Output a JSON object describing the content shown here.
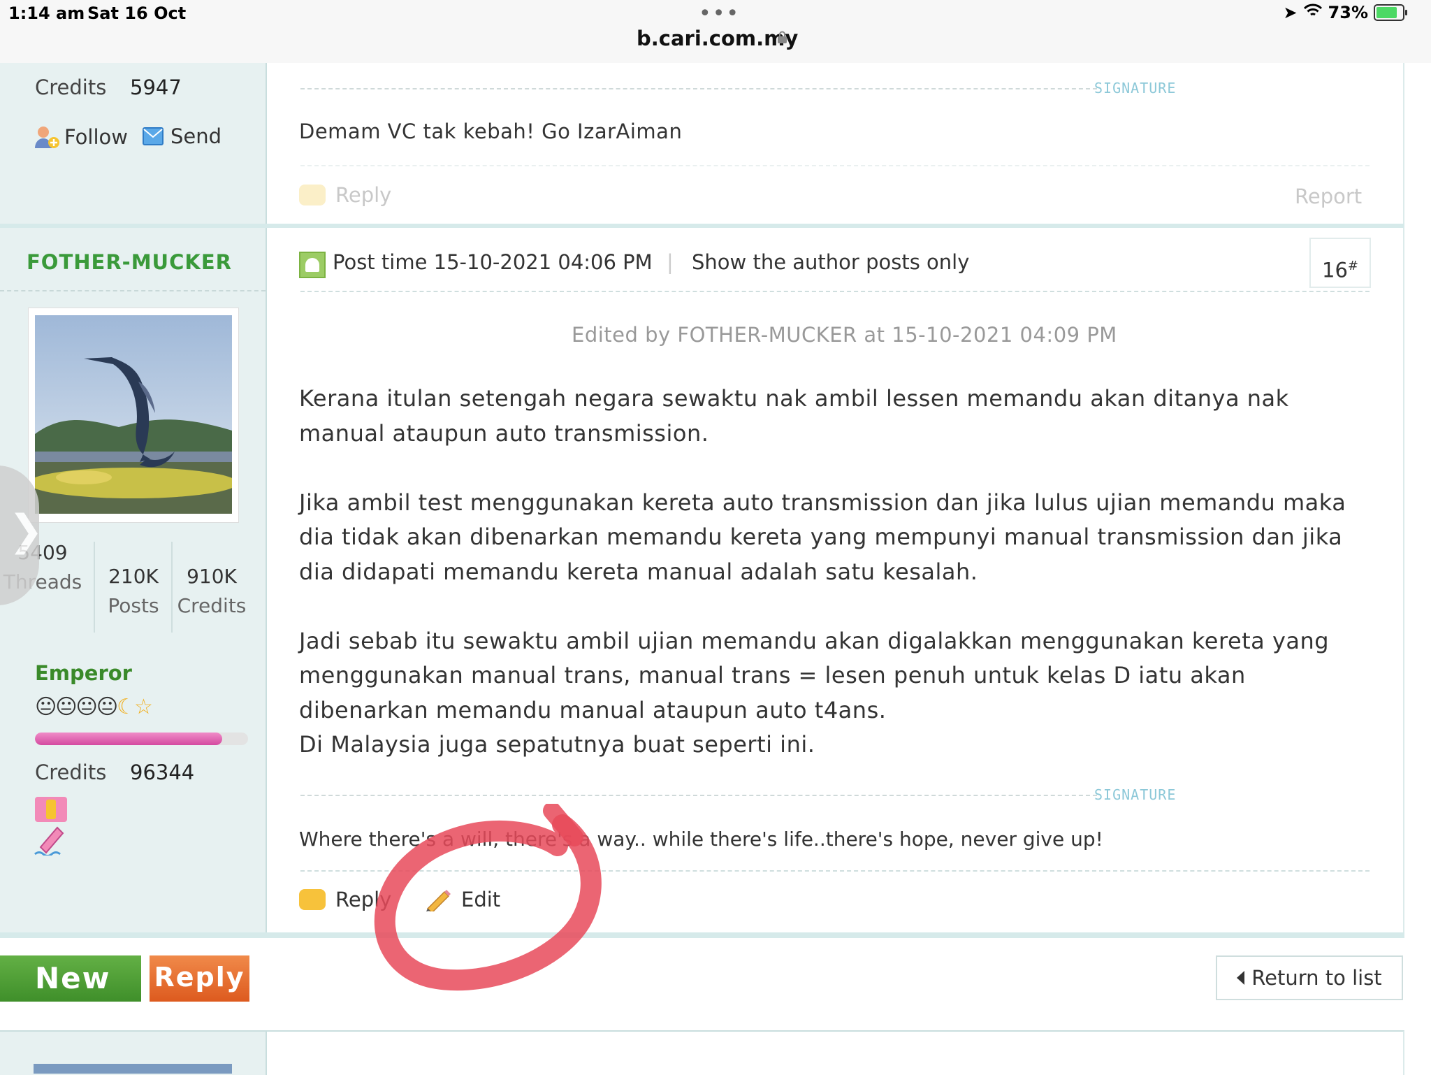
{
  "status_bar": {
    "time": "1:14 am",
    "date": "Sat 16 Oct",
    "url": "b.cari.com.my",
    "battery": "73%"
  },
  "prev_post": {
    "credits_label": "Credits",
    "credits_value": "5947",
    "follow_label": "Follow",
    "send_label": "Send",
    "signature_label": "SIGNATURE",
    "signature_text": "Demam VC tak kebah! Go IzarAiman",
    "reply_label": "Reply",
    "report_label": "Report"
  },
  "post": {
    "author": "FOTHER-MUCKER",
    "stats": [
      {
        "value": "5409",
        "label": "Threads"
      },
      {
        "value": "210K",
        "label": "Posts"
      },
      {
        "value": "910K",
        "label": "Credits"
      }
    ],
    "rank": "Emperor",
    "rank_progress": 0.88,
    "credits_label": "Credits",
    "credits_value": "96344",
    "post_time": "Post time 15-10-2021 04:06 PM",
    "separator": "|",
    "show_author_only": "Show the author posts only",
    "floor_number": "16",
    "floor_mark": "#",
    "edited_by": "Edited by FOTHER-MUCKER at 15-10-2021 04:09 PM",
    "paragraphs": [
      "Kerana itulan setengah negara sewaktu nak ambil lessen memandu akan ditanya nak manual ataupun auto transmission.",
      "Jika ambil test menggunakan kereta auto transmission dan jika lulus ujian memandu maka dia tidak akan dibenarkan memandu kereta yang mempunyi manual transmission dan jika dia didapati memandu kereta manual adalah satu kesalah.",
      "Jadi sebab itu sewaktu ambil ujian memandu akan digalakkan menggunakan kereta yang menggunakan manual trans, manual trans = lesen penuh untuk kelas D iatu akan dibenarkan memandu manual ataupun auto t4ans.\nDi Malaysia juga sepatutnya buat seperti ini."
    ],
    "signature_label": "SIGNATURE",
    "signature_text": "Where there's a will, there's a way.. while there's life..there's hope, never give up!",
    "reply_label": "Reply",
    "edit_label": "Edit"
  },
  "bottom": {
    "new_label": "New",
    "reply_label": "Reply",
    "return_label": "Return to list"
  },
  "colors": {
    "username": "#3a9a3a",
    "annotation_circle": "#e84a5a",
    "new_button": "#4c9e35",
    "reply_button": "#e86a2e"
  }
}
